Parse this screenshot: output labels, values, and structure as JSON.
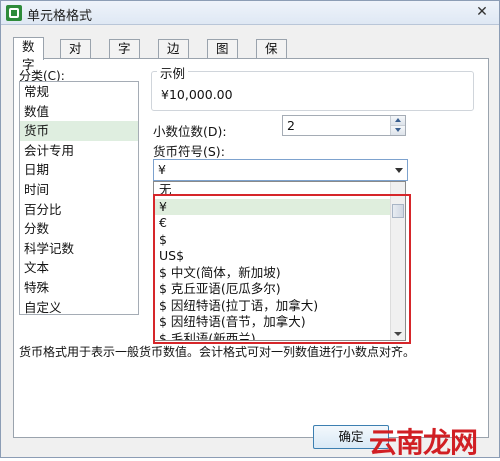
{
  "window": {
    "title": "单元格格式",
    "close_glyph": "✕"
  },
  "tabs": [
    {
      "label": "数字",
      "active": true
    },
    {
      "label": "对齐",
      "active": false
    },
    {
      "label": "字体",
      "active": false
    },
    {
      "label": "边框",
      "active": false
    },
    {
      "label": "图案",
      "active": false
    },
    {
      "label": "保护",
      "active": false
    }
  ],
  "category": {
    "label": "分类(C):",
    "items": [
      "常规",
      "数值",
      "货币",
      "会计专用",
      "日期",
      "时间",
      "百分比",
      "分数",
      "科学记数",
      "文本",
      "特殊",
      "自定义"
    ],
    "selected": "货币"
  },
  "sample": {
    "title": "示例",
    "value": "¥10,000.00"
  },
  "decimal": {
    "label": "小数位数(D):",
    "value": "2"
  },
  "symbol": {
    "label": "货币符号(S):",
    "selected": "¥",
    "options": [
      "无",
      "¥",
      "€",
      "$",
      "US$",
      "$ 中文(简体，新加坡)",
      "$ 克丘亚语(厄瓜多尔)",
      "$ 因纽特语(拉丁语，加拿大)",
      "$ 因纽特语(音节，加拿大)",
      "$ 毛利语(新西兰)"
    ],
    "highlighted": "¥"
  },
  "description": "货币格式用于表示一般货币数值。会计格式可对一列数值进行小数点对齐。",
  "buttons": {
    "ok": "确定"
  },
  "watermark": {
    "text": "云南龙网"
  },
  "colors": {
    "highlight_box": "#d6262a",
    "selection": "#dfeee0",
    "watermark": "#d11f24"
  }
}
